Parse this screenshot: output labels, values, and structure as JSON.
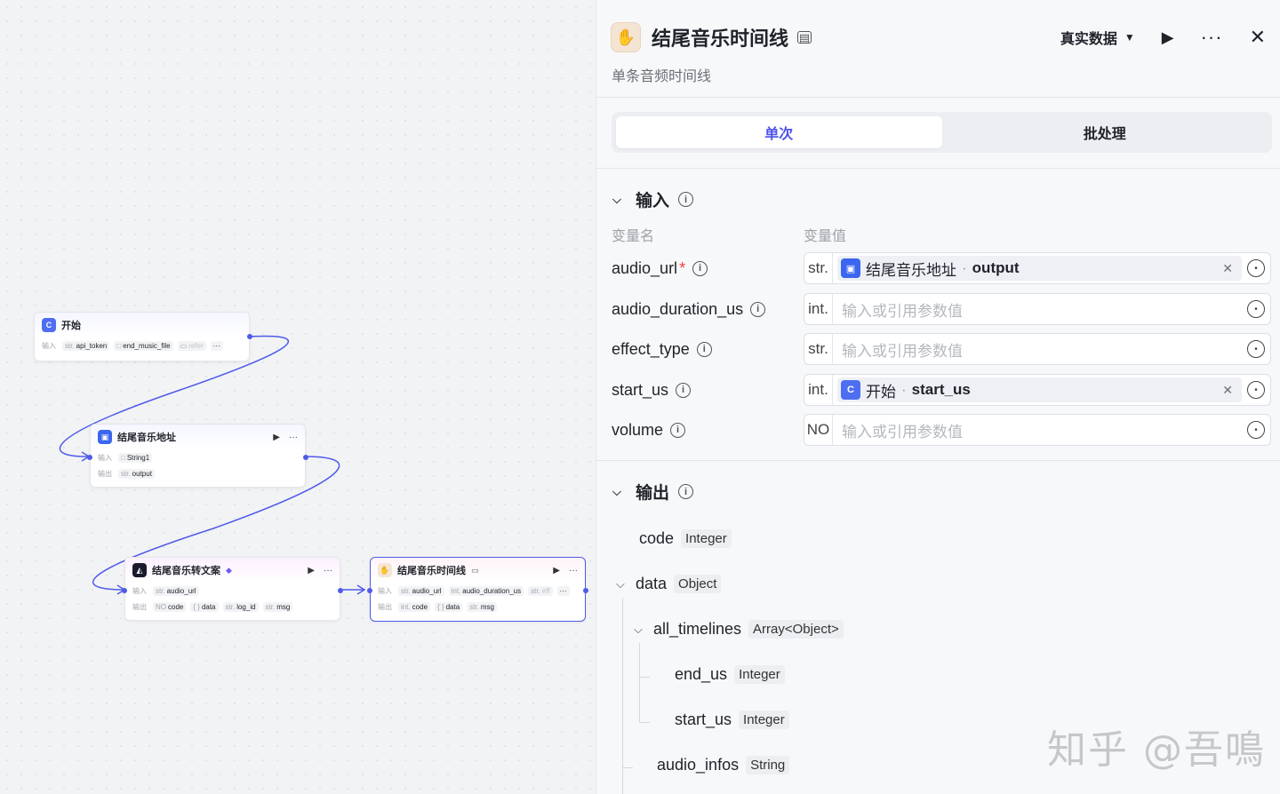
{
  "canvas": {
    "nodes": {
      "start": {
        "title": "开始",
        "icon": "start-icon",
        "input_label": "输入",
        "inputs": [
          {
            "type": "str.",
            "name": "api_token"
          },
          {
            "type": "□",
            "name": "end_music_file"
          },
          {
            "type": "▭",
            "name": "refer"
          }
        ],
        "more": "···"
      },
      "music_addr": {
        "title": "结尾音乐地址",
        "icon": "plugin-icon",
        "input_label": "输入",
        "output_label": "输出",
        "inputs": [
          {
            "type": "□",
            "name": "String1"
          }
        ],
        "outputs": [
          {
            "type": "str.",
            "name": "output"
          }
        ]
      },
      "transcribe": {
        "title": "结尾音乐转文案",
        "icon": "ai-icon",
        "input_label": "输入",
        "output_label": "输出",
        "inputs": [
          {
            "type": "str.",
            "name": "audio_url"
          }
        ],
        "outputs": [
          {
            "type": "NO",
            "name": "code"
          },
          {
            "type": "{ }",
            "name": "data"
          },
          {
            "type": "str.",
            "name": "log_id"
          },
          {
            "type": "str.",
            "name": "msg"
          }
        ]
      },
      "timeline": {
        "title": "结尾音乐时间线",
        "icon": "handshake-icon",
        "input_label": "输入",
        "output_label": "输出",
        "inputs": [
          {
            "type": "str.",
            "name": "audio_url"
          },
          {
            "type": "int.",
            "name": "audio_duration_us"
          },
          {
            "type": "str.",
            "name": "eff"
          }
        ],
        "outputs": [
          {
            "type": "int.",
            "name": "code"
          },
          {
            "type": "{ }",
            "name": "data"
          },
          {
            "type": "str.",
            "name": "msg"
          }
        ],
        "more": "···"
      }
    }
  },
  "panel": {
    "title": "结尾音乐时间线",
    "subtitle": "单条音频时间线",
    "dataset_label": "真实数据",
    "tabs": [
      {
        "label": "单次",
        "active": true
      },
      {
        "label": "批处理",
        "active": false
      }
    ],
    "input_section": {
      "title": "输入",
      "col_name": "变量名",
      "col_value": "变量值",
      "rows": [
        {
          "name": "audio_url",
          "required": true,
          "type": "str.",
          "ref_node": "结尾音乐地址",
          "ref_var": "output",
          "ref_icon": "plugin-icon",
          "ref_color": "#3a66f0"
        },
        {
          "name": "audio_duration_us",
          "required": false,
          "type": "int.",
          "placeholder": "输入或引用参数值"
        },
        {
          "name": "effect_type",
          "required": false,
          "type": "str.",
          "placeholder": "输入或引用参数值"
        },
        {
          "name": "start_us",
          "required": false,
          "type": "int.",
          "ref_node": "开始",
          "ref_var": "start_us",
          "ref_icon": "start-icon",
          "ref_color": "#4e6ef2"
        },
        {
          "name": "volume",
          "required": false,
          "type": "NO",
          "placeholder": "输入或引用参数值"
        }
      ]
    },
    "output_section": {
      "title": "输出",
      "fields": [
        {
          "name": "code",
          "type": "Integer"
        },
        {
          "name": "data",
          "type": "Object"
        },
        {
          "name": "all_timelines",
          "type": "Array<Object>"
        },
        {
          "name": "end_us",
          "type": "Integer"
        },
        {
          "name": "start_us",
          "type": "Integer"
        },
        {
          "name": "audio_infos",
          "type": "String"
        }
      ]
    }
  },
  "watermark": "知乎 @吾鳴",
  "colors": {
    "accent": "#4d53e8",
    "wire": "#4e5be8",
    "required": "#f53f3f"
  }
}
